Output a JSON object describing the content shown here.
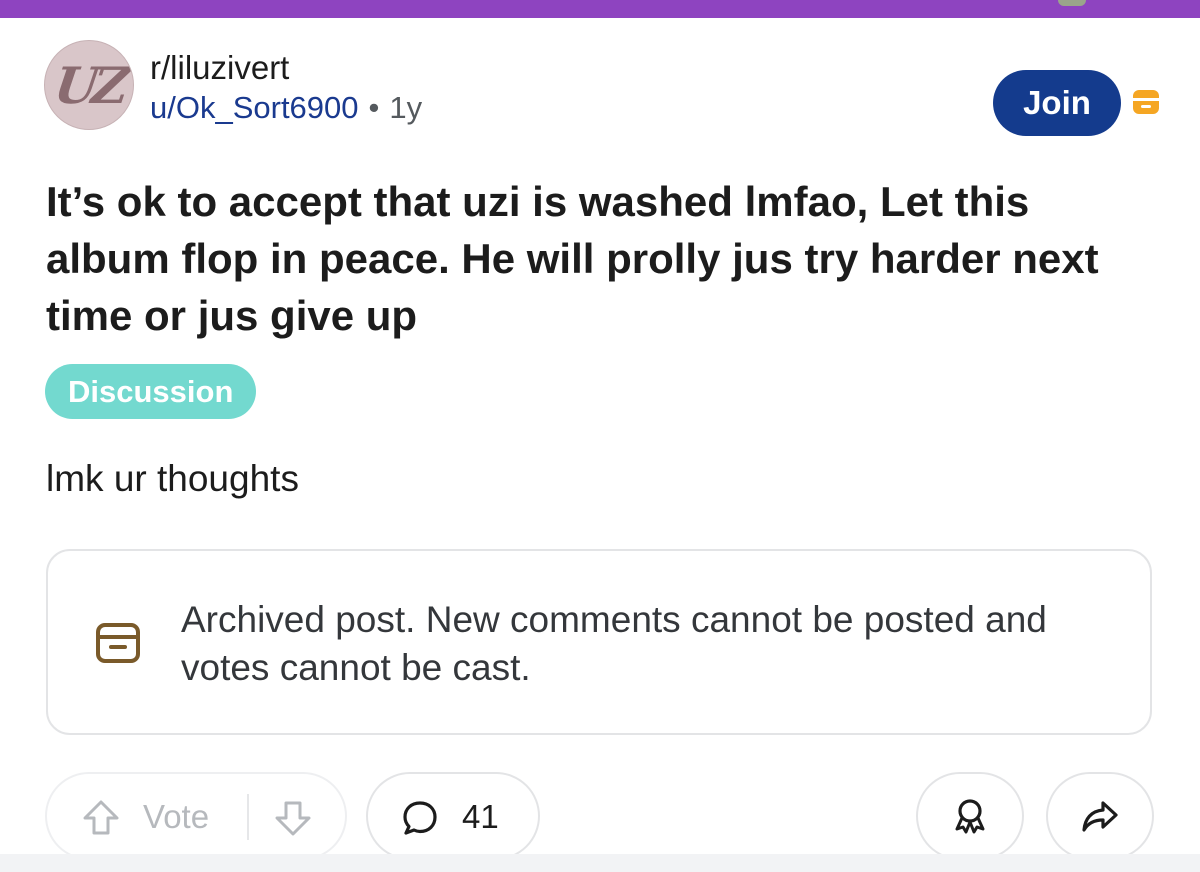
{
  "post": {
    "avatar_icon": "subreddit-avatar-icon",
    "subreddit": "r/liluzivert",
    "author": "u/Ok_Sort6900",
    "separator": "•",
    "age": "1y",
    "join_label": "Join",
    "archived_badge_icon": "archive-icon",
    "title": "It’s ok to accept that uzi is washed lmfao, Let this album flop in peace. He will prolly jus try harder next time or jus give up",
    "flair": "Discussion",
    "body": "lmk ur thoughts"
  },
  "archived_notice": {
    "icon": "archive-icon",
    "text": "Archived post. New comments cannot be posted and votes cannot be cast."
  },
  "actions": {
    "upvote_icon": "arrow-up-icon",
    "vote_label": "Vote",
    "downvote_icon": "arrow-down-icon",
    "comment_icon": "comment-bubble-icon",
    "comment_count": "41",
    "award_icon": "award-icon",
    "share_icon": "share-arrow-icon"
  },
  "colors": {
    "header_bar": "#8e44c0",
    "join_button": "#143b8d",
    "flair": "#73d9cf",
    "archive_badge": "#f5a623",
    "archive_icon": "#7a5a2a"
  }
}
